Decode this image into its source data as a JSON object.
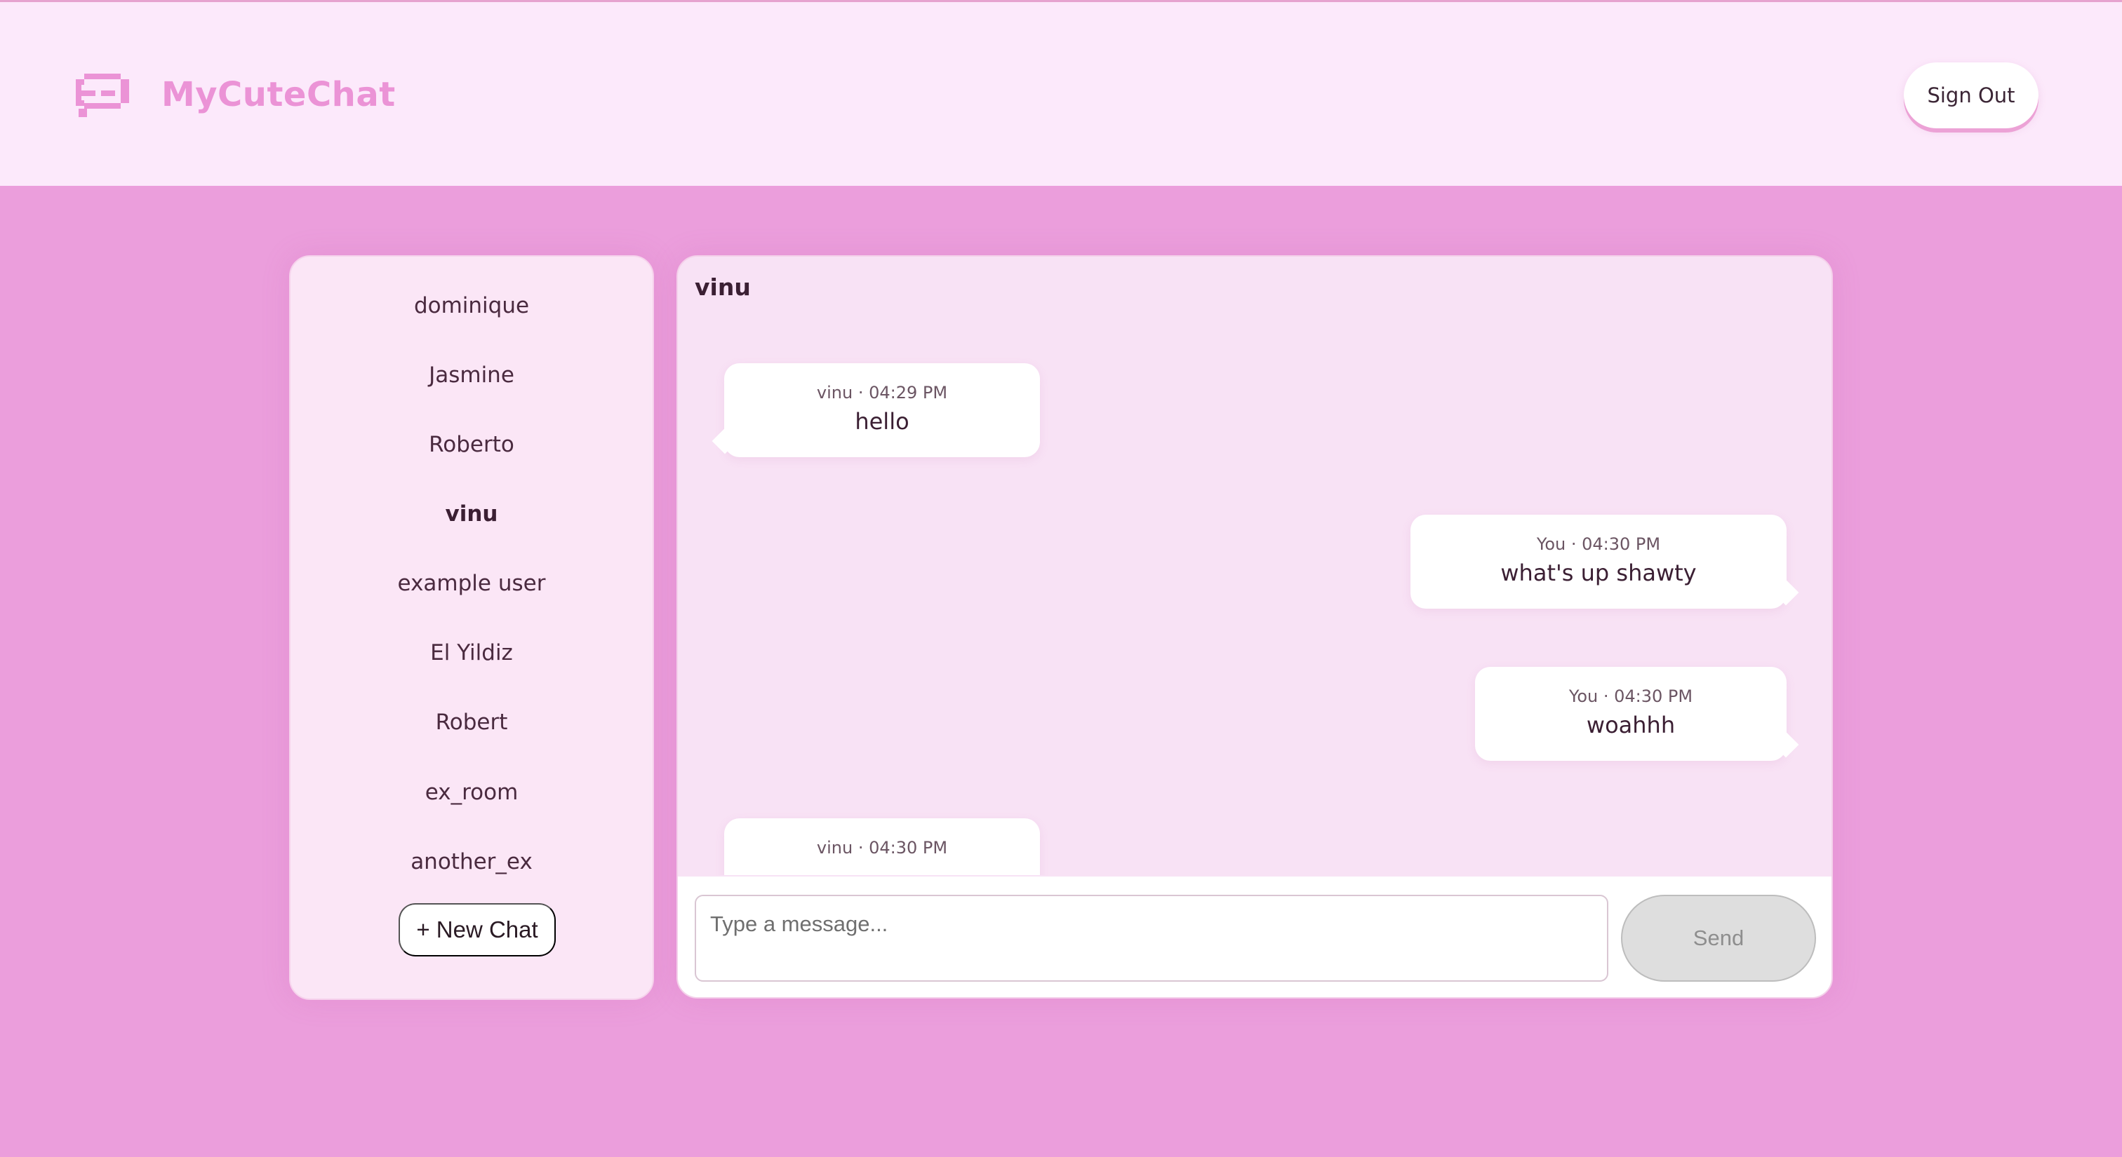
{
  "app": {
    "name": "MyCuteChat",
    "brand_color": "#eb93d6",
    "background_color": "#eb9edc",
    "logo_icon": "chat-bubble-icon"
  },
  "header": {
    "sign_out_label": "Sign Out"
  },
  "sidebar": {
    "rooms": [
      {
        "label": "dominique",
        "active": false
      },
      {
        "label": "Jasmine",
        "active": false
      },
      {
        "label": "Roberto",
        "active": false
      },
      {
        "label": "vinu",
        "active": true
      },
      {
        "label": "example user",
        "active": false
      },
      {
        "label": "El Yildiz",
        "active": false
      },
      {
        "label": "Robert",
        "active": false
      },
      {
        "label": "ex_room",
        "active": false
      },
      {
        "label": "another_ex",
        "active": false
      }
    ],
    "new_chat_label": "+ New Chat"
  },
  "chat": {
    "title": "vinu",
    "messages": [
      {
        "meta": "vinu · 04:29 PM",
        "text": "hello",
        "from_self": false
      },
      {
        "meta": "You · 04:30 PM",
        "text": "what's up shawty",
        "from_self": true
      },
      {
        "meta": "You · 04:30 PM",
        "text": "woahhh",
        "from_self": true
      },
      {
        "meta": "vinu · 04:30 PM",
        "text": "",
        "from_self": false
      }
    ],
    "input_placeholder": "Type a message...",
    "send_label": "Send"
  }
}
